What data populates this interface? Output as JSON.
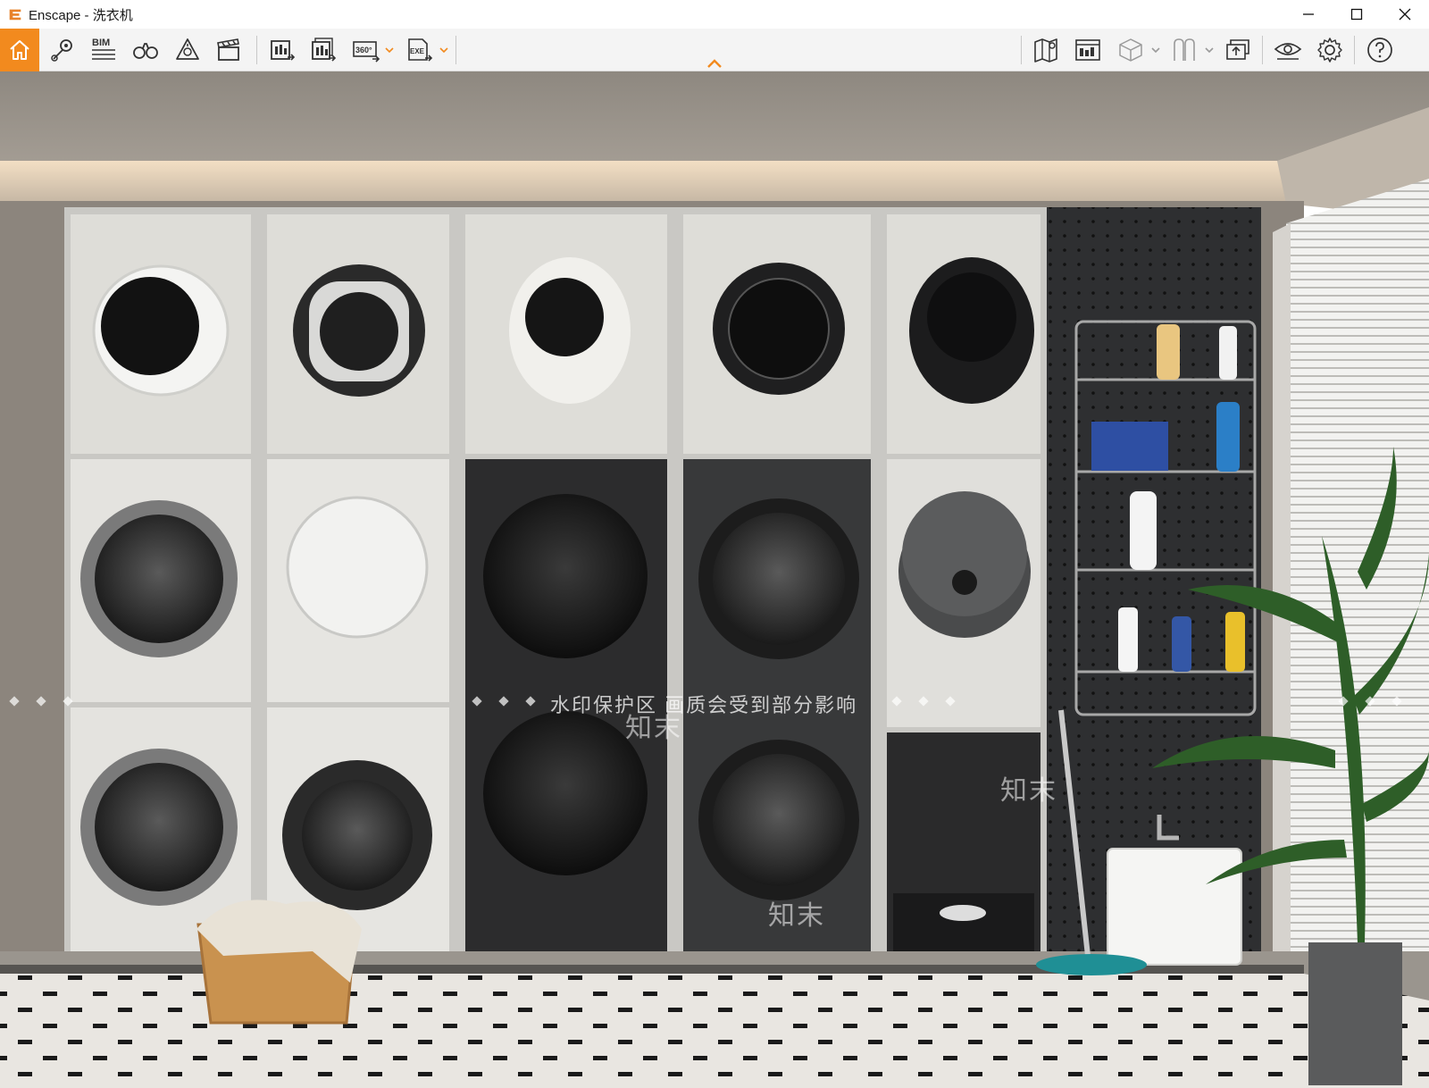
{
  "window": {
    "title": "Enscape - 洗衣机",
    "controls": [
      "minimize-icon",
      "maximize-icon",
      "close-icon"
    ]
  },
  "toolbar": {
    "left_items": [
      {
        "name": "home",
        "icon": "home-icon",
        "active": true
      },
      {
        "name": "views",
        "icon": "location-pin-icon"
      },
      {
        "name": "bim",
        "icon": "bim-icon",
        "label": "BIM"
      },
      {
        "name": "walk-mode",
        "icon": "binoculars-icon"
      },
      {
        "name": "atmosphere",
        "icon": "atmosphere-icon"
      },
      {
        "name": "video-editor",
        "icon": "clapperboard-icon"
      },
      {
        "name": "screenshot",
        "icon": "render-export-icon"
      },
      {
        "name": "batch-render",
        "icon": "batch-render-icon"
      },
      {
        "name": "panorama",
        "icon": "panorama-360-icon",
        "label": "360°"
      },
      {
        "name": "export-exe",
        "icon": "exe-export-icon",
        "label": "EXE"
      }
    ],
    "right_items": [
      {
        "name": "map",
        "icon": "map-icon"
      },
      {
        "name": "minimap",
        "icon": "minimap-icon"
      },
      {
        "name": "asset-library",
        "icon": "cube-icon"
      },
      {
        "name": "materials",
        "icon": "materials-icon"
      },
      {
        "name": "upload",
        "icon": "upload-icon"
      },
      {
        "name": "visual-settings",
        "icon": "eye-icon"
      },
      {
        "name": "settings",
        "icon": "gear-icon"
      },
      {
        "name": "help",
        "icon": "help-icon"
      }
    ],
    "accent_color": "#f28a1e"
  },
  "viewport": {
    "watermark": "水印保护区   画质会受到部分影响",
    "watermark_brand": "知末"
  }
}
